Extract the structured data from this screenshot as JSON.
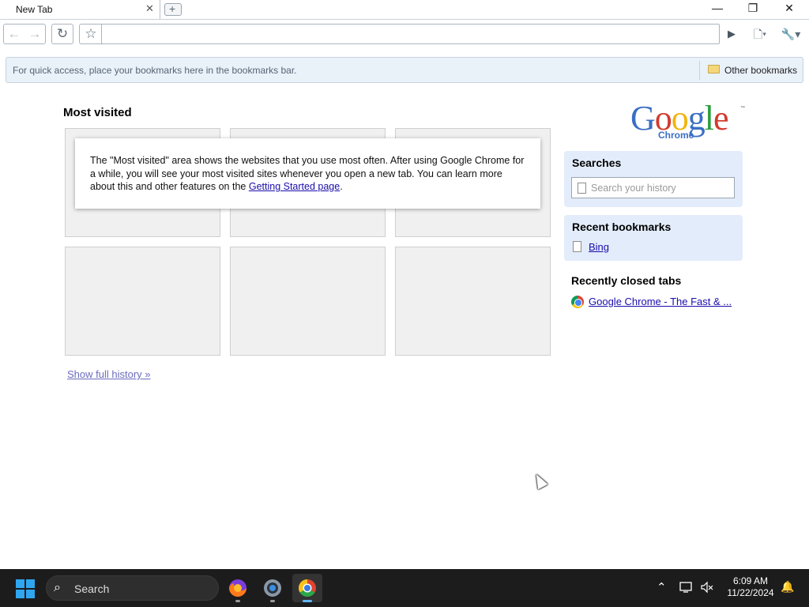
{
  "window": {
    "tab_title": "New Tab",
    "tab_close": "✕",
    "new_tab_symbol": "+",
    "minimize": "—",
    "restore": "❐",
    "close": "✕"
  },
  "toolbar": {
    "back_icon": "←",
    "forward_icon": "→",
    "reload_icon": "↻",
    "star_icon": "☆",
    "omnibox_value": "",
    "go_icon": "▶",
    "page_menu_icon": "🗋▾",
    "wrench_menu_icon": "🔧▾"
  },
  "bookmarks_bar": {
    "hint": "For quick access, place your bookmarks here in the bookmarks bar.",
    "other_bookmarks": "Other bookmarks"
  },
  "most_visited": {
    "title": "Most visited",
    "info_text_before": "The \"Most visited\" area shows the websites that you use most often. After using Google Chrome for a while, you will see your most visited sites whenever you open a new tab. You can learn more about this and other features on the ",
    "info_link": "Getting Started page",
    "info_text_after": ".",
    "show_full_history": "Show full history »"
  },
  "logo": {
    "letters": [
      "G",
      "o",
      "o",
      "g",
      "l",
      "e"
    ],
    "colors": [
      "#3a6fc4",
      "#d13b2e",
      "#f2b40f",
      "#3a6fc4",
      "#2a9d3b",
      "#d13b2e"
    ],
    "subtitle": "Chrome",
    "tm": "™"
  },
  "sidebar": {
    "searches_title": "Searches",
    "search_placeholder": "Search your history",
    "recent_bookmarks_title": "Recent bookmarks",
    "recent_bookmark": "Bing",
    "recently_closed_title": "Recently closed tabs",
    "recently_closed_item": "Google Chrome - The Fast & ..."
  },
  "taskbar": {
    "search_label": "Search",
    "search_icon": "⌕",
    "time": "6:09 AM",
    "date": "11/22/2024",
    "tray_chevron": "⌃",
    "notification_icon": "🔔",
    "apps": [
      "firefox-icon",
      "settings-icon",
      "chrome-icon"
    ]
  }
}
